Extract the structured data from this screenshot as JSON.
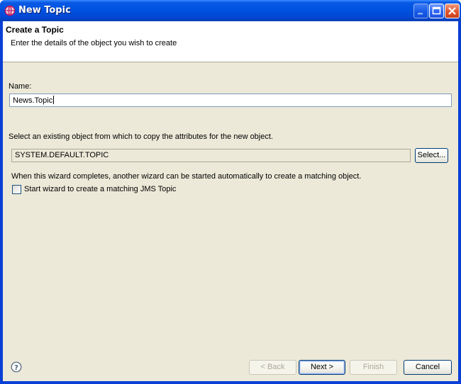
{
  "window": {
    "title": "New Topic"
  },
  "banner": {
    "title": "Create a Topic",
    "description": "Enter the details of the object you wish to create"
  },
  "form": {
    "name_label": "Name:",
    "name_value": "News.Topic",
    "copy_label": "Select an existing object from which to copy the attributes for the new object.",
    "copy_value": "SYSTEM.DEFAULT.TOPIC",
    "select_button": "Select...",
    "wizard_note": "When this wizard completes, another wizard can be started automatically to create a matching object.",
    "wizard_checkbox_label": "Start wizard to create a matching JMS Topic",
    "wizard_checkbox_checked": false
  },
  "footer": {
    "back_button": "< Back",
    "next_button": "Next >",
    "finish_button": "Finish",
    "cancel_button": "Cancel"
  },
  "icons": {
    "app": "wizard-globe-icon",
    "help": "help-icon",
    "minimize": "minimize-icon",
    "maximize": "maximize-icon",
    "close": "close-icon"
  },
  "colors": {
    "titlebar": "#0052e0",
    "dialog_bg": "#ece9d8",
    "banner_bg": "#ffffff",
    "input_border": "#7f9db9"
  }
}
